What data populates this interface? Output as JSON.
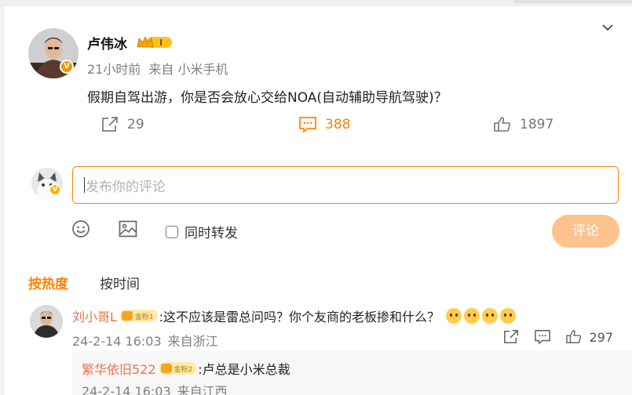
{
  "post": {
    "author": "卢伟冰",
    "level": "I",
    "time": "21小时前",
    "source": "来自 小米手机",
    "text": "假期自驾出游，你是否会放心交给NOA(自动辅助导航驾驶)？",
    "share_count": "29",
    "comment_count": "388",
    "like_count": "1897",
    "verified_badge": "V"
  },
  "composer": {
    "placeholder": "发布你的评论",
    "repost_label": "同时转发",
    "submit_label": "评论"
  },
  "sort": {
    "hot": "按热度",
    "time": "按时间"
  },
  "comments": [
    {
      "name": "刘小哥L",
      "fan_label": "金粉1",
      "text": ":这不应该是雷总问吗？你个友商的老板掺和什么？",
      "time": "24-2-14 16:03",
      "location": "来自浙江",
      "like_count": "297"
    }
  ],
  "replies": [
    {
      "name": "繁华依旧522",
      "fan_label": "金粉2",
      "text": ":卢总是小米总裁",
      "time": "24-2-14 16:03",
      "location": "来自江西"
    }
  ],
  "colors": {
    "accent": "#ff8200",
    "name": "#eb7350",
    "submit_disabled": "#ffc28c"
  },
  "icons": [
    "chevron-down-icon",
    "share-icon",
    "comment-icon",
    "like-icon",
    "emoji-icon",
    "image-icon",
    "reply-icon"
  ]
}
